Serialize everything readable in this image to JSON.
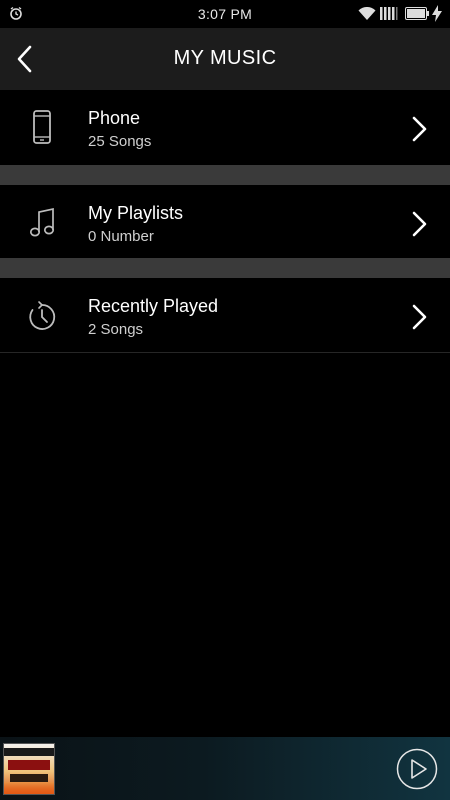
{
  "status_bar": {
    "time": "3:07 PM",
    "icons": [
      "alarm-icon",
      "wifi-icon",
      "signal-icon",
      "battery-icon",
      "charging-icon"
    ]
  },
  "header": {
    "title": "MY MUSIC",
    "back_icon": "chevron-left-icon"
  },
  "items": [
    {
      "icon": "phone-icon",
      "title": "Phone",
      "subtitle": "25 Songs"
    },
    {
      "icon": "music-note-icon",
      "title": "My Playlists",
      "subtitle": "0 Number"
    },
    {
      "icon": "clock-icon",
      "title": "Recently Played",
      "subtitle": "2 Songs"
    }
  ],
  "player": {
    "play_icon": "play-icon",
    "album_art_icon": "album-art-thumbnail"
  },
  "colors": {
    "background": "#000000",
    "header": "#1c1c1c",
    "separator": "#3a3a3a",
    "text_primary": "#ffffff",
    "text_secondary": "#cfcfcf"
  }
}
